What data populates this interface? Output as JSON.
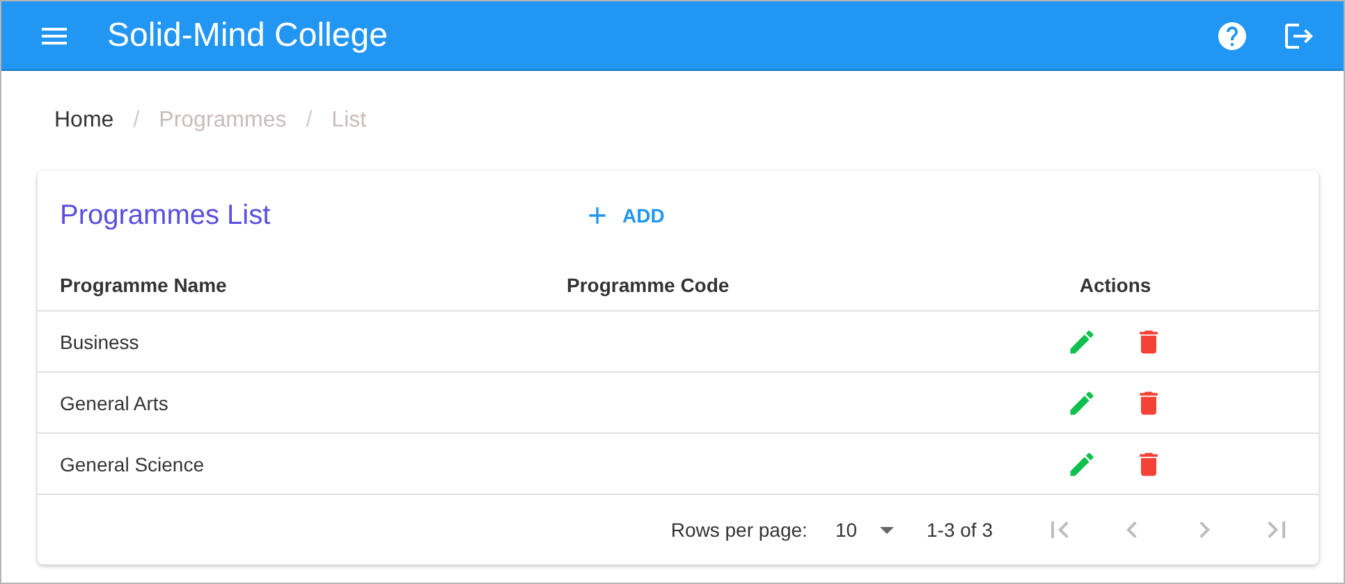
{
  "app_bar": {
    "title": "Solid-Mind College"
  },
  "breadcrumbs": [
    {
      "label": "Home",
      "current": false
    },
    {
      "label": "Programmes",
      "current": true
    },
    {
      "label": "List",
      "current": true
    }
  ],
  "breadcrumb_separators": [
    "/",
    "/"
  ],
  "card": {
    "title": "Programmes List",
    "add_button": "ADD"
  },
  "table": {
    "columns": [
      "Programme Name",
      "Programme Code",
      "Actions"
    ],
    "rows": [
      {
        "name": "Business"
      },
      {
        "name": "General Arts"
      },
      {
        "name": "General Science"
      }
    ]
  },
  "pagination": {
    "rows_per_page_label": "Rows per page:",
    "rows_per_page": "10",
    "range": "1-3 of 3",
    "buttons": [
      {
        "kind": "first",
        "disabled": true
      },
      {
        "kind": "prev",
        "disabled": true
      },
      {
        "kind": "next",
        "disabled": true
      },
      {
        "kind": "last",
        "disabled": true
      }
    ]
  }
}
